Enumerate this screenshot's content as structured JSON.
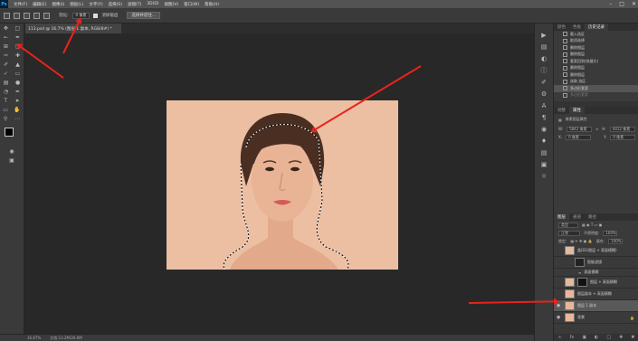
{
  "menubar": {
    "logo": "Ps",
    "items": [
      "文件(F)",
      "编辑(E)",
      "图像(I)",
      "图层(L)",
      "文字(Y)",
      "选择(S)",
      "滤镜(T)",
      "3D(D)",
      "视图(V)",
      "窗口(W)",
      "帮助(H)"
    ]
  },
  "options": {
    "feather_label": "羽化:",
    "feather_value": "0 像素",
    "antialias_label": "消除锯齿",
    "select_mask_button": "选择并遮住..."
  },
  "document": {
    "tab_label": "113.psd @ 16.7% (图层 1 副本, RGB/8#) *"
  },
  "status": {
    "zoom": "16.67%",
    "doc_size": "文档:13.2M/26.6M"
  },
  "history": {
    "tabs": [
      "颜色",
      "色板",
      "历史记录"
    ],
    "items": [
      "载入选区",
      "取消选择",
      "删除图层",
      "删除图层",
      "套索回到(快捷方)",
      "删除图层",
      "删除图层",
      "选取 选区",
      "多边形套索",
      "多边形套索"
    ]
  },
  "properties": {
    "tabs": [
      "调整",
      "属性"
    ],
    "section": "像素图层属性",
    "w_label": "W:",
    "w_value": "5842 像素",
    "h_label": "H:",
    "h_value": "4412 像素",
    "x_label": "X:",
    "x_value": "0 像素",
    "y_label": "Y:",
    "y_value": "0 像素"
  },
  "layers": {
    "tabs": [
      "图层",
      "通道",
      "路径"
    ],
    "kind_label": "类型",
    "blend_mode": "正常",
    "opacity_label": "不透明度:",
    "opacity_value": "100%",
    "lock_label": "锁定:",
    "fill_label": "填充:",
    "fill_value": "100%",
    "rows": [
      {
        "name": "盖印2(图层 + 表面模糊)",
        "thumb": "skin",
        "visible": false,
        "selected": false
      },
      {
        "name": "智能滤镜",
        "thumb": "dark",
        "visible": false,
        "selected": false
      },
      {
        "name": "表面模糊",
        "thumb": "none",
        "visible": false,
        "selected": false
      },
      {
        "name": "图层 + 表面模糊",
        "thumb": "mask",
        "visible": false,
        "selected": false
      },
      {
        "name": "图层副本 + 表面模糊",
        "thumb": "skin",
        "visible": false,
        "selected": false
      },
      {
        "name": "图层 1 副本",
        "thumb": "skin",
        "visible": true,
        "selected": true
      },
      {
        "name": "背景",
        "thumb": "skin",
        "visible": true,
        "selected": false
      }
    ]
  },
  "colors": {
    "annotation_arrow": "#e8231c",
    "image_background": "#ecbfa3",
    "app_bg": "#282828"
  }
}
